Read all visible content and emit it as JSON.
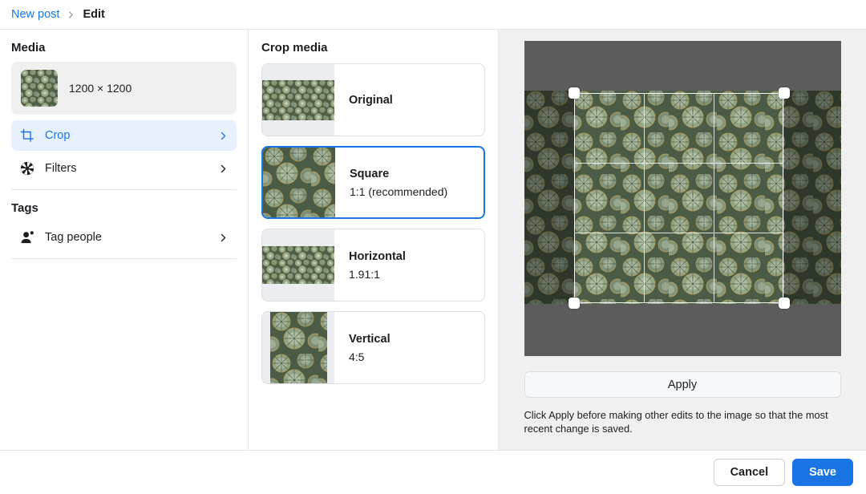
{
  "header": {
    "breadcrumb_link": "New post",
    "breadcrumb_separator": "chevron-right-icon",
    "breadcrumb_current": "Edit"
  },
  "sidebar": {
    "media_section_title": "Media",
    "media": {
      "dimensions": "1200 × 1200",
      "thumb_icon": "succulent-thumbnail"
    },
    "rows": [
      {
        "label": "Crop",
        "icon": "crop-icon",
        "active": true,
        "chevron": "chevron-right-icon"
      },
      {
        "label": "Filters",
        "icon": "aperture-icon",
        "active": false,
        "chevron": "chevron-right-icon"
      }
    ],
    "tags_section_title": "Tags",
    "tag_rows": [
      {
        "label": "Tag people",
        "icon": "person-add-icon",
        "active": false,
        "chevron": "chevron-right-icon"
      }
    ]
  },
  "croplist": {
    "title": "Crop media",
    "options": [
      {
        "name": "Original",
        "ratio": "",
        "selected": false
      },
      {
        "name": "Square",
        "ratio": "1:1 (recommended)",
        "selected": true
      },
      {
        "name": "Horizontal",
        "ratio": "1.91:1",
        "selected": false
      },
      {
        "name": "Vertical",
        "ratio": "4:5",
        "selected": false
      }
    ]
  },
  "preview": {
    "apply_label": "Apply",
    "hint": "Click Apply before making other edits to the image so that the most recent change is saved.",
    "image_alt": "succulent-plants-photo",
    "crop_handles": [
      "top-left",
      "top-right",
      "bottom-left",
      "bottom-right"
    ],
    "grid": "rule-of-thirds"
  },
  "footer": {
    "cancel_label": "Cancel",
    "save_label": "Save"
  },
  "colors": {
    "accent": "#1b74e4",
    "accent_soft": "#e7f0fd",
    "panel_bg": "#f0f0f0",
    "border": "#e4e6eb",
    "stage_bg": "#5c5c5c"
  }
}
